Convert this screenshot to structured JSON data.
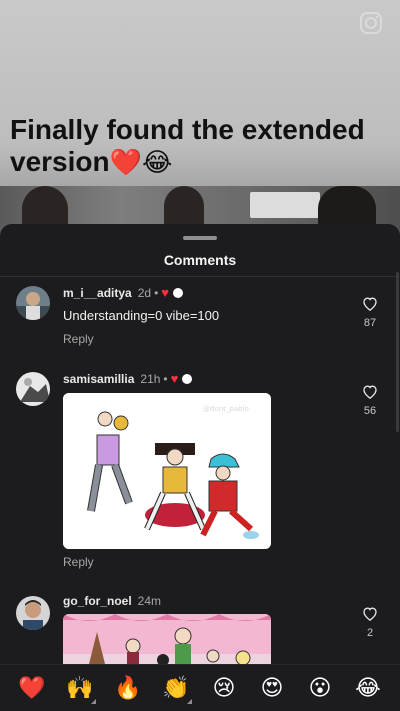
{
  "reel": {
    "caption_text": "Finally found the extended version",
    "caption_emojis": "❤️😂",
    "camera_icon": "camera-icon"
  },
  "sheet": {
    "title": "Comments"
  },
  "comments": [
    {
      "username": "m_i__aditya",
      "time": "2d",
      "text": "Understanding=0  vibe=100",
      "reply_label": "Reply",
      "likes": "87",
      "reactions": [
        "red-heart",
        "white-circle"
      ]
    },
    {
      "username": "samisamillia",
      "time": "21h",
      "text": "",
      "reply_label": "Reply",
      "likes": "56",
      "attachment": "gif",
      "gif_watermark": "@dont_pablo",
      "reactions": [
        "red-heart",
        "white-circle"
      ]
    },
    {
      "username": "go_for_noel",
      "time": "24m",
      "text": "",
      "likes": "2",
      "attachment": "gif"
    }
  ],
  "emoji_bar": [
    "❤️",
    "🙌",
    "🔥",
    "👏",
    "😢",
    "😍",
    "😮",
    "😂"
  ],
  "colors": {
    "sheet_bg": "#1c1c1e",
    "heart": "#ff3040",
    "muted_text": "#a8a8a8"
  }
}
